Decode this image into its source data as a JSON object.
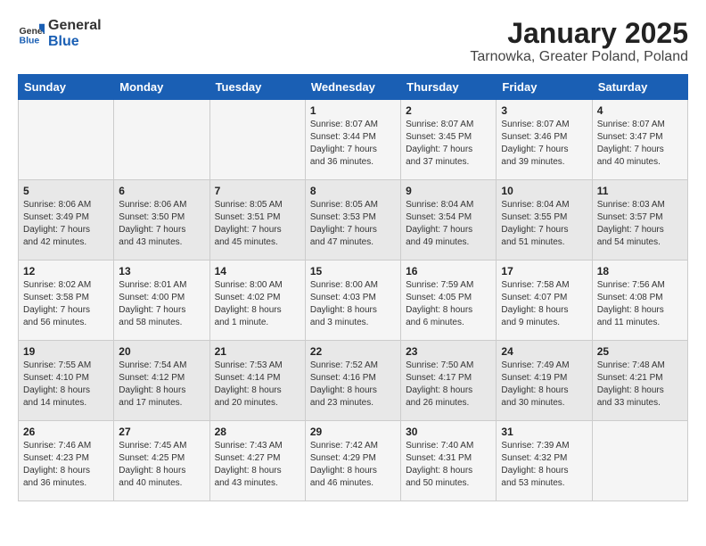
{
  "header": {
    "logo_general": "General",
    "logo_blue": "Blue",
    "title": "January 2025",
    "subtitle": "Tarnowka, Greater Poland, Poland"
  },
  "days_of_week": [
    "Sunday",
    "Monday",
    "Tuesday",
    "Wednesday",
    "Thursday",
    "Friday",
    "Saturday"
  ],
  "weeks": [
    [
      {
        "day": "",
        "info": ""
      },
      {
        "day": "",
        "info": ""
      },
      {
        "day": "",
        "info": ""
      },
      {
        "day": "1",
        "info": "Sunrise: 8:07 AM\nSunset: 3:44 PM\nDaylight: 7 hours\nand 36 minutes."
      },
      {
        "day": "2",
        "info": "Sunrise: 8:07 AM\nSunset: 3:45 PM\nDaylight: 7 hours\nand 37 minutes."
      },
      {
        "day": "3",
        "info": "Sunrise: 8:07 AM\nSunset: 3:46 PM\nDaylight: 7 hours\nand 39 minutes."
      },
      {
        "day": "4",
        "info": "Sunrise: 8:07 AM\nSunset: 3:47 PM\nDaylight: 7 hours\nand 40 minutes."
      }
    ],
    [
      {
        "day": "5",
        "info": "Sunrise: 8:06 AM\nSunset: 3:49 PM\nDaylight: 7 hours\nand 42 minutes."
      },
      {
        "day": "6",
        "info": "Sunrise: 8:06 AM\nSunset: 3:50 PM\nDaylight: 7 hours\nand 43 minutes."
      },
      {
        "day": "7",
        "info": "Sunrise: 8:05 AM\nSunset: 3:51 PM\nDaylight: 7 hours\nand 45 minutes."
      },
      {
        "day": "8",
        "info": "Sunrise: 8:05 AM\nSunset: 3:53 PM\nDaylight: 7 hours\nand 47 minutes."
      },
      {
        "day": "9",
        "info": "Sunrise: 8:04 AM\nSunset: 3:54 PM\nDaylight: 7 hours\nand 49 minutes."
      },
      {
        "day": "10",
        "info": "Sunrise: 8:04 AM\nSunset: 3:55 PM\nDaylight: 7 hours\nand 51 minutes."
      },
      {
        "day": "11",
        "info": "Sunrise: 8:03 AM\nSunset: 3:57 PM\nDaylight: 7 hours\nand 54 minutes."
      }
    ],
    [
      {
        "day": "12",
        "info": "Sunrise: 8:02 AM\nSunset: 3:58 PM\nDaylight: 7 hours\nand 56 minutes."
      },
      {
        "day": "13",
        "info": "Sunrise: 8:01 AM\nSunset: 4:00 PM\nDaylight: 7 hours\nand 58 minutes."
      },
      {
        "day": "14",
        "info": "Sunrise: 8:00 AM\nSunset: 4:02 PM\nDaylight: 8 hours\nand 1 minute."
      },
      {
        "day": "15",
        "info": "Sunrise: 8:00 AM\nSunset: 4:03 PM\nDaylight: 8 hours\nand 3 minutes."
      },
      {
        "day": "16",
        "info": "Sunrise: 7:59 AM\nSunset: 4:05 PM\nDaylight: 8 hours\nand 6 minutes."
      },
      {
        "day": "17",
        "info": "Sunrise: 7:58 AM\nSunset: 4:07 PM\nDaylight: 8 hours\nand 9 minutes."
      },
      {
        "day": "18",
        "info": "Sunrise: 7:56 AM\nSunset: 4:08 PM\nDaylight: 8 hours\nand 11 minutes."
      }
    ],
    [
      {
        "day": "19",
        "info": "Sunrise: 7:55 AM\nSunset: 4:10 PM\nDaylight: 8 hours\nand 14 minutes."
      },
      {
        "day": "20",
        "info": "Sunrise: 7:54 AM\nSunset: 4:12 PM\nDaylight: 8 hours\nand 17 minutes."
      },
      {
        "day": "21",
        "info": "Sunrise: 7:53 AM\nSunset: 4:14 PM\nDaylight: 8 hours\nand 20 minutes."
      },
      {
        "day": "22",
        "info": "Sunrise: 7:52 AM\nSunset: 4:16 PM\nDaylight: 8 hours\nand 23 minutes."
      },
      {
        "day": "23",
        "info": "Sunrise: 7:50 AM\nSunset: 4:17 PM\nDaylight: 8 hours\nand 26 minutes."
      },
      {
        "day": "24",
        "info": "Sunrise: 7:49 AM\nSunset: 4:19 PM\nDaylight: 8 hours\nand 30 minutes."
      },
      {
        "day": "25",
        "info": "Sunrise: 7:48 AM\nSunset: 4:21 PM\nDaylight: 8 hours\nand 33 minutes."
      }
    ],
    [
      {
        "day": "26",
        "info": "Sunrise: 7:46 AM\nSunset: 4:23 PM\nDaylight: 8 hours\nand 36 minutes."
      },
      {
        "day": "27",
        "info": "Sunrise: 7:45 AM\nSunset: 4:25 PM\nDaylight: 8 hours\nand 40 minutes."
      },
      {
        "day": "28",
        "info": "Sunrise: 7:43 AM\nSunset: 4:27 PM\nDaylight: 8 hours\nand 43 minutes."
      },
      {
        "day": "29",
        "info": "Sunrise: 7:42 AM\nSunset: 4:29 PM\nDaylight: 8 hours\nand 46 minutes."
      },
      {
        "day": "30",
        "info": "Sunrise: 7:40 AM\nSunset: 4:31 PM\nDaylight: 8 hours\nand 50 minutes."
      },
      {
        "day": "31",
        "info": "Sunrise: 7:39 AM\nSunset: 4:32 PM\nDaylight: 8 hours\nand 53 minutes."
      },
      {
        "day": "",
        "info": ""
      }
    ]
  ]
}
